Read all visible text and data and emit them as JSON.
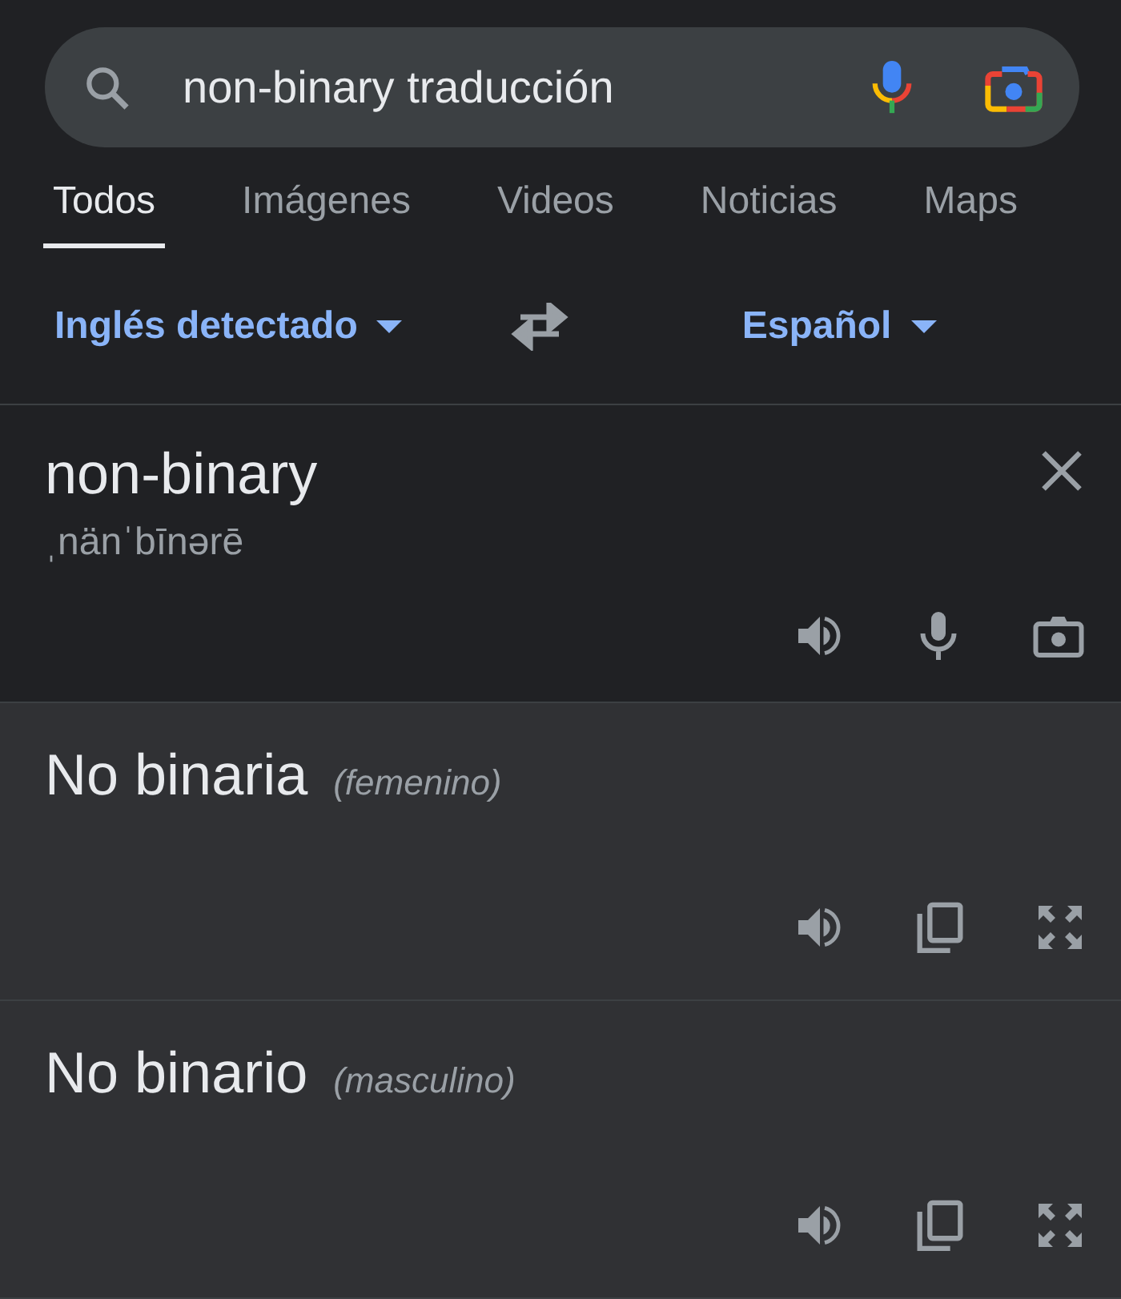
{
  "search": {
    "value": "non-binary traducción"
  },
  "tabs": [
    {
      "label": "Todos",
      "selected": true
    },
    {
      "label": "Imágenes",
      "selected": false
    },
    {
      "label": "Videos",
      "selected": false
    },
    {
      "label": "Noticias",
      "selected": false
    },
    {
      "label": "Maps",
      "selected": false
    }
  ],
  "languages": {
    "source": "Inglés detectado",
    "target": "Español"
  },
  "source": {
    "text": "non-binary",
    "phonetic": "ˌnänˈbīnərē"
  },
  "translations": [
    {
      "text": "No binaria",
      "gender": "(femenino)"
    },
    {
      "text": "No binario",
      "gender": "(masculino)"
    }
  ]
}
